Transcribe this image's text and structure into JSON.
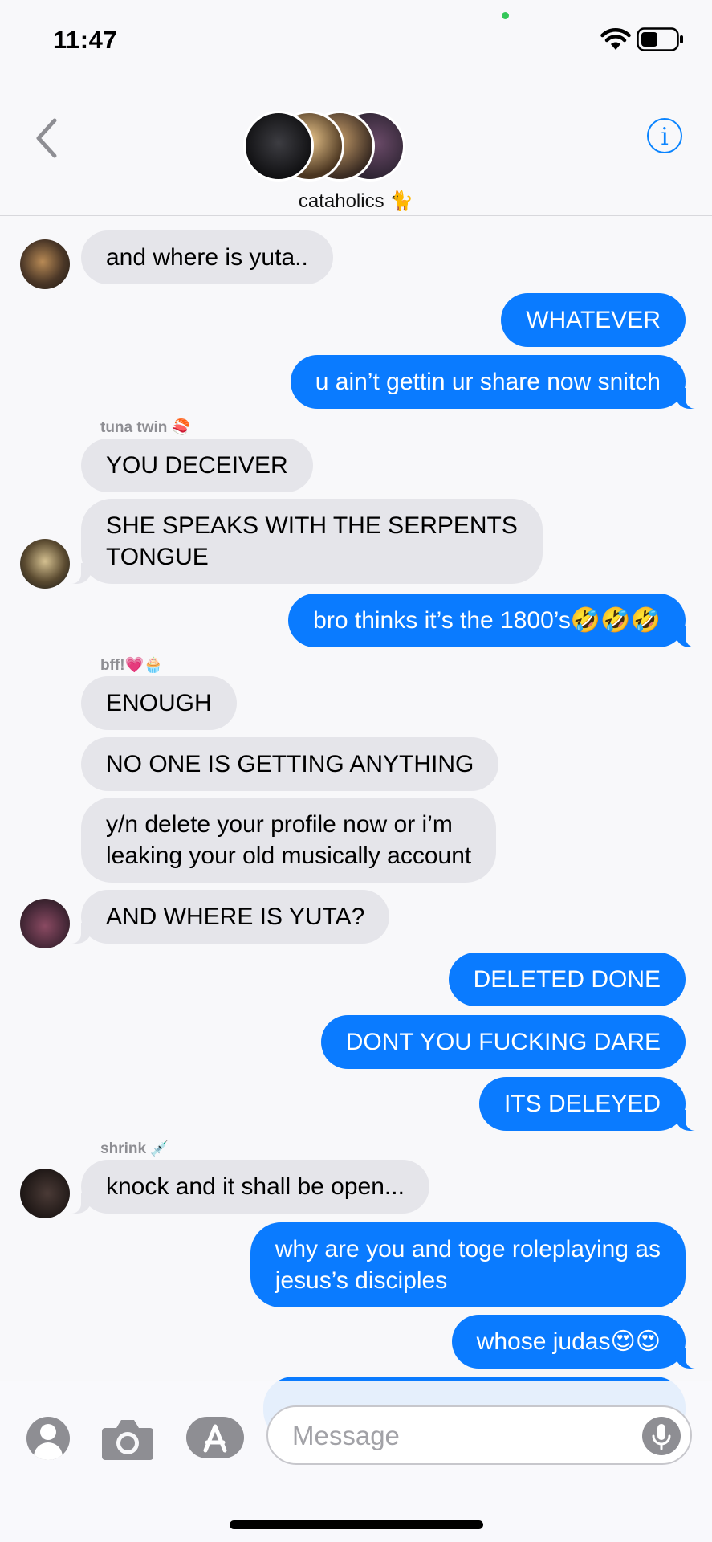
{
  "status": {
    "time": "11:47"
  },
  "nav": {
    "group_name": "cataholics 🐈",
    "info_label": "i"
  },
  "messages": [
    {
      "text": "and where is yuta..",
      "dir": "in"
    },
    {
      "text": "WHATEVER",
      "dir": "out"
    },
    {
      "text": "u ain’t gettin ur share now snitch",
      "dir": "out"
    },
    {
      "text": "YOU DECEIVER",
      "dir": "in"
    },
    {
      "text": "SHE SPEAKS WITH THE SERPENTS\nTONGUE",
      "dir": "in"
    },
    {
      "text": "bro thinks it’s the 1800’s🤣🤣🤣",
      "dir": "out"
    },
    {
      "text": "ENOUGH",
      "dir": "in"
    },
    {
      "text": "NO ONE IS GETTING ANYTHING",
      "dir": "in"
    },
    {
      "text": "y/n delete your profile now or i’m\nleaking your old musically account",
      "dir": "in"
    },
    {
      "text": "AND WHERE IS YUTA?",
      "dir": "in"
    },
    {
      "text": "DELETED DONE",
      "dir": "out"
    },
    {
      "text": "DONT YOU FUCKING DARE",
      "dir": "out"
    },
    {
      "text": "ITS DELEYED",
      "dir": "out"
    },
    {
      "text": "knock and it shall be open...",
      "dir": "in"
    },
    {
      "text": "why are you and toge roleplaying as\njesus’s disciples",
      "dir": "out"
    },
    {
      "text": "whose judas😍😍",
      "dir": "out"
    }
  ],
  "senders": {
    "tuna": "tuna twin 🍣",
    "bff": "bff!💗🧁",
    "shrink": "shrink 💉"
  },
  "input": {
    "placeholder": "Message"
  },
  "colors": {
    "accent": "#0a7bff",
    "incoming": "#e5e5ea"
  },
  "icons": [
    "back-chevron-icon",
    "info-icon",
    "contact-icon",
    "camera-icon",
    "app-store-icon",
    "mic-icon",
    "wifi-icon",
    "battery-icon"
  ]
}
